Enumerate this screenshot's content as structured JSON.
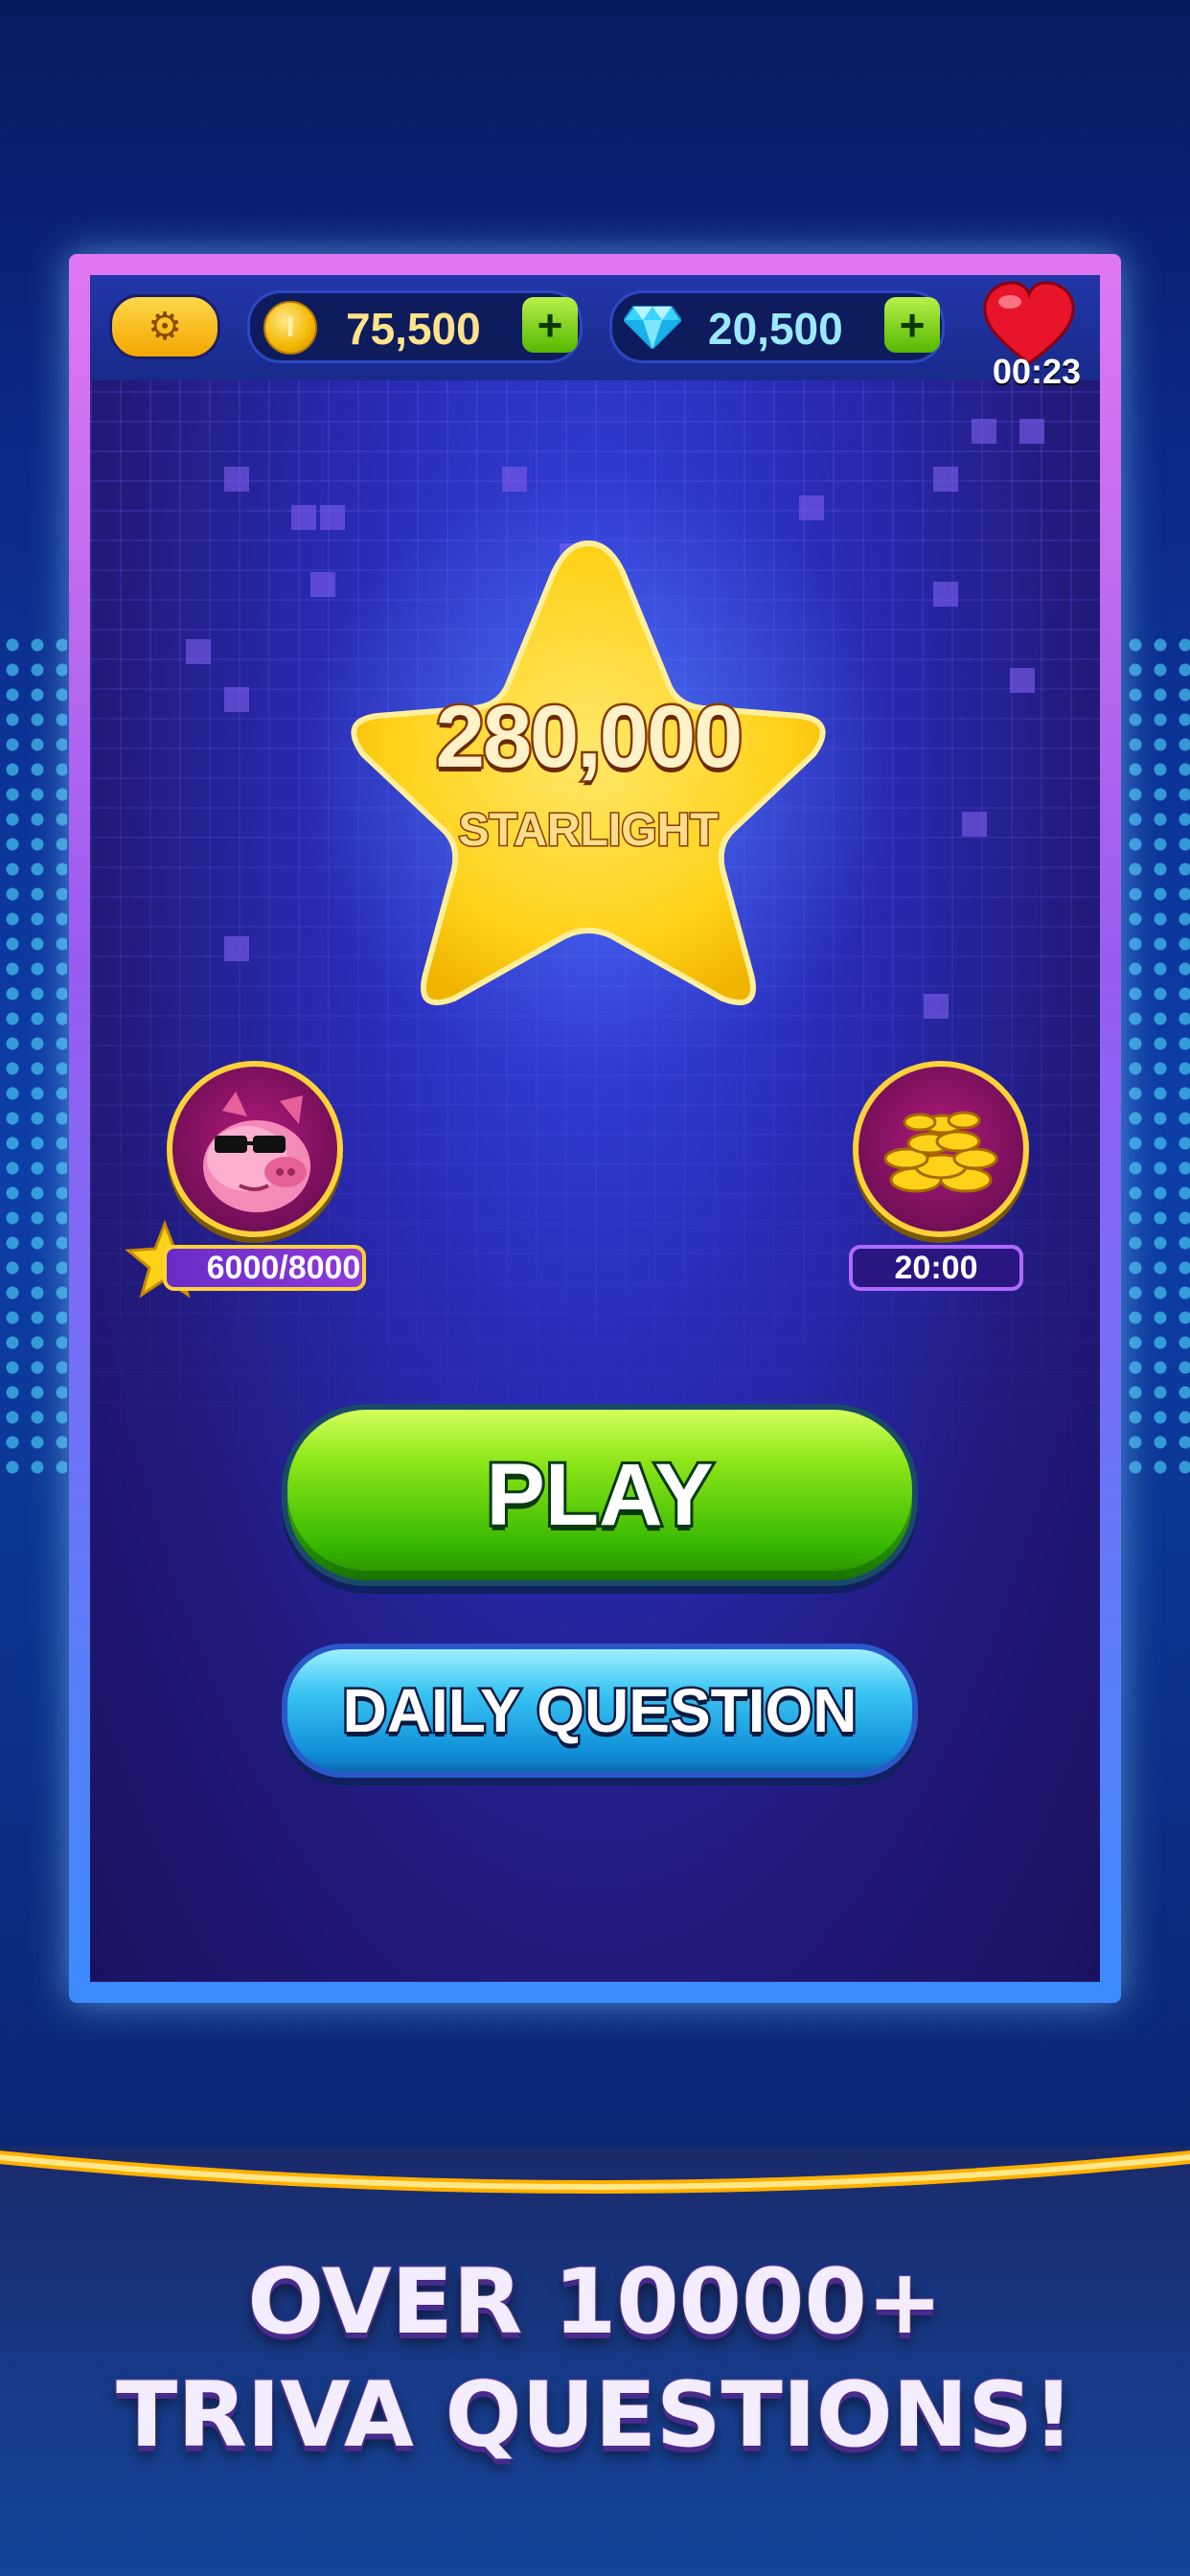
{
  "top_bar": {
    "coins": "75,500",
    "coin_symbol": "I",
    "gems": "20,500",
    "plus_label": "+",
    "lives_timer": "00:23"
  },
  "score": {
    "value": "280,000",
    "label": "STARLIGHT"
  },
  "piggy_bank": {
    "progress_text": "6000/8000",
    "progress_fraction": 0.75
  },
  "coin_reward": {
    "timer": "20:00"
  },
  "buttons": {
    "play": "PLAY",
    "daily_question": "DAILY QUESTION"
  },
  "promo": {
    "line1": "OVER 10000+",
    "line2": "TRIVA QUESTIONS!"
  },
  "colors": {
    "frame_accent": "#e078f0",
    "play_green": "#36b800",
    "daily_blue": "#108ed8",
    "gold": "#ffd23a"
  }
}
